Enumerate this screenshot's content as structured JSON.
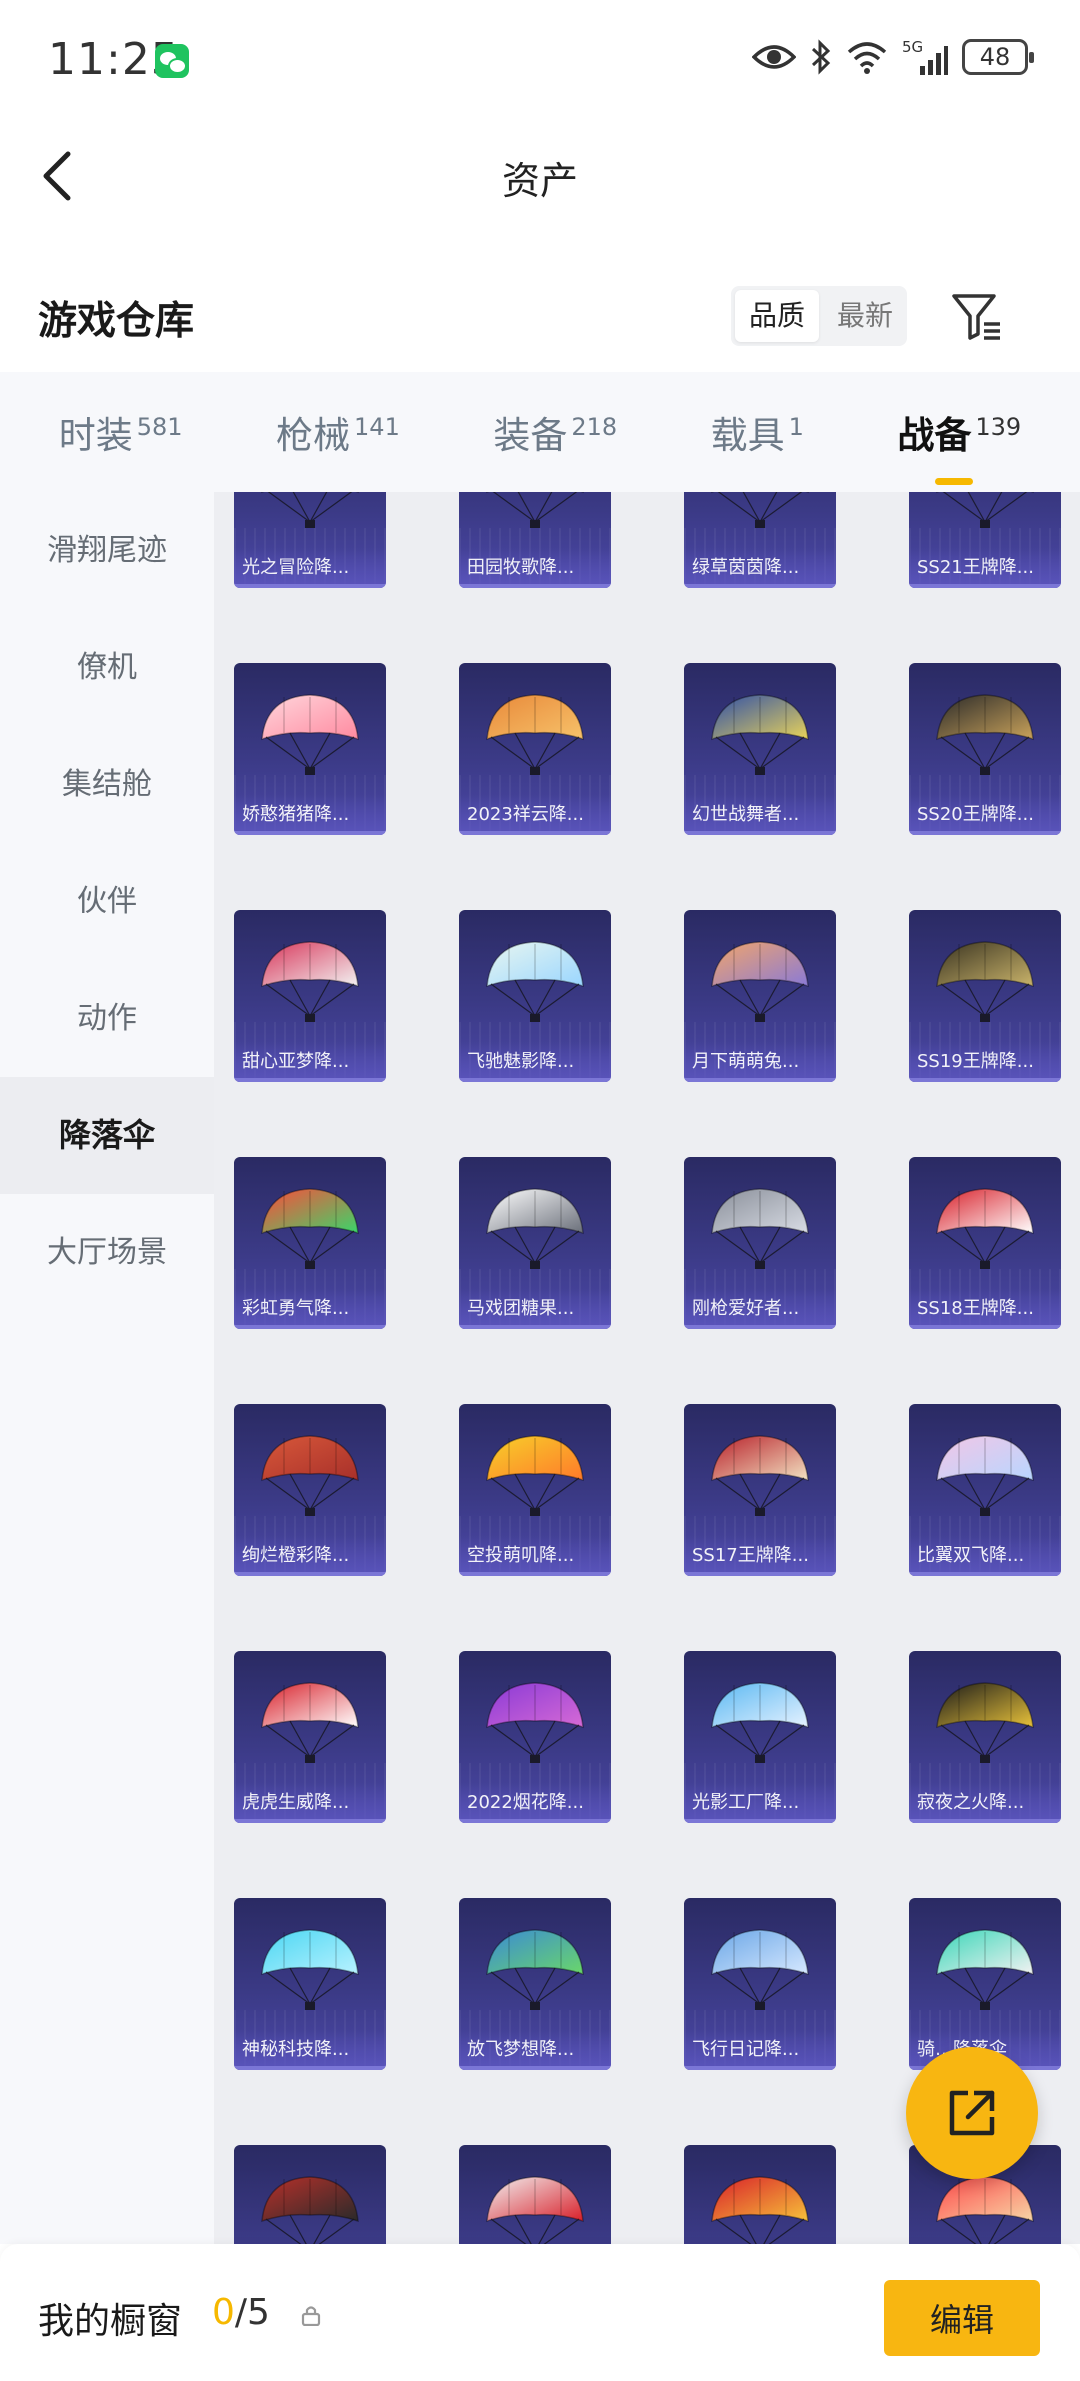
{
  "status_bar": {
    "time": "11:25",
    "network": "5G",
    "battery": "48"
  },
  "header": {
    "title": "资产"
  },
  "section": {
    "title": "游戏仓库",
    "sort_options": [
      {
        "label": "品质",
        "active": true
      },
      {
        "label": "最新",
        "active": false
      }
    ]
  },
  "tabs": [
    {
      "label": "时装",
      "count": "581",
      "active": false
    },
    {
      "label": "枪械",
      "count": "141",
      "active": false
    },
    {
      "label": "装备",
      "count": "218",
      "active": false
    },
    {
      "label": "载具",
      "count": "1",
      "active": false
    },
    {
      "label": "战备",
      "count": "139",
      "active": true
    }
  ],
  "sidebar": {
    "items": [
      {
        "label": "滑翔尾迹",
        "active": false
      },
      {
        "label": "僚机",
        "active": false
      },
      {
        "label": "集结舱",
        "active": false
      },
      {
        "label": "伙伴",
        "active": false
      },
      {
        "label": "动作",
        "active": false
      },
      {
        "label": "降落伞",
        "active": true
      },
      {
        "label": "大厅场景",
        "active": false
      }
    ]
  },
  "items": [
    {
      "label": "光之冒险降...",
      "colors": [
        "#f5d34a",
        "#ffffff"
      ]
    },
    {
      "label": "田园牧歌降...",
      "colors": [
        "#e6e47a",
        "#cfe38a"
      ]
    },
    {
      "label": "绿草茵茵降...",
      "colors": [
        "#2fd08a",
        "#ff6b8a"
      ]
    },
    {
      "label": "SS21王牌降...",
      "colors": [
        "#dfe6ea",
        "#3a7d6a"
      ]
    },
    {
      "label": "娇憨猪猪降...",
      "colors": [
        "#ffd6dc",
        "#ff8aa0"
      ]
    },
    {
      "label": "2023祥云降...",
      "colors": [
        "#e8893a",
        "#f7c26a"
      ]
    },
    {
      "label": "幻世战舞者...",
      "colors": [
        "#2f4fa8",
        "#e8d35a"
      ]
    },
    {
      "label": "SS20王牌降...",
      "colors": [
        "#2a2a2a",
        "#c9a25a"
      ]
    },
    {
      "label": "甜心亚梦降...",
      "colors": [
        "#d8365a",
        "#f2f2f2"
      ]
    },
    {
      "label": "飞驰魅影降...",
      "colors": [
        "#e8f6f0",
        "#9ad6ff"
      ]
    },
    {
      "label": "月下萌萌兔...",
      "colors": [
        "#f2a56a",
        "#8a7ad6"
      ]
    },
    {
      "label": "SS19王牌降...",
      "colors": [
        "#3a3422",
        "#c9b36a"
      ]
    },
    {
      "label": "彩虹勇气降...",
      "colors": [
        "#ff4a3a",
        "#3ad66a"
      ]
    },
    {
      "label": "马戏团糖果...",
      "colors": [
        "#ffffff",
        "#6a6f7a"
      ]
    },
    {
      "label": "刚枪爱好者...",
      "colors": [
        "#8a8f9a",
        "#d8dce4"
      ]
    },
    {
      "label": "SS18王牌降...",
      "colors": [
        "#d8202a",
        "#ffffff"
      ]
    },
    {
      "label": "绚烂橙彩降...",
      "colors": [
        "#d8583a",
        "#a8302a"
      ]
    },
    {
      "label": "空投萌叽降...",
      "colors": [
        "#f7d02a",
        "#ff7a2a"
      ]
    },
    {
      "label": "SS17王牌降...",
      "colors": [
        "#b8202a",
        "#f2e2c2"
      ]
    },
    {
      "label": "比翼双飞降...",
      "colors": [
        "#f2c6e6",
        "#b8d6ff"
      ]
    },
    {
      "label": "虎虎生威降...",
      "colors": [
        "#d8202a",
        "#ffffff"
      ]
    },
    {
      "label": "2022烟花降...",
      "colors": [
        "#8a3ad6",
        "#d66ad6"
      ]
    },
    {
      "label": "光影工厂降...",
      "colors": [
        "#5ab8f2",
        "#e6f2ff"
      ]
    },
    {
      "label": "寂夜之火降...",
      "colors": [
        "#1a1a1a",
        "#e8c23a"
      ]
    },
    {
      "label": "神秘科技降...",
      "colors": [
        "#4ad6f2",
        "#b8f2ff"
      ]
    },
    {
      "label": "放飞梦想降...",
      "colors": [
        "#3a8ad6",
        "#6ad66a"
      ]
    },
    {
      "label": "飞行日记降...",
      "colors": [
        "#6aa6e6",
        "#d6e8ff"
      ]
    },
    {
      "label": "骑…降落伞",
      "colors": [
        "#3ad6b8",
        "#f2f2f2"
      ]
    },
    {
      "label": "",
      "colors": [
        "#b8302a",
        "#2a2a2a"
      ]
    },
    {
      "label": "",
      "colors": [
        "#f2f2f2",
        "#d8202a"
      ]
    },
    {
      "label": "",
      "colors": [
        "#d8202a",
        "#f7c23a"
      ]
    },
    {
      "label": "",
      "colors": [
        "#ff4a4a",
        "#f7d6a6"
      ]
    }
  ],
  "bottom_bar": {
    "label": "我的橱窗",
    "used": "0",
    "total": "/5",
    "edit_label": "编辑"
  },
  "icons": {
    "back": "chevron-left-icon",
    "filter": "filter-icon",
    "share": "share-external-icon",
    "lock": "lock-icon"
  }
}
